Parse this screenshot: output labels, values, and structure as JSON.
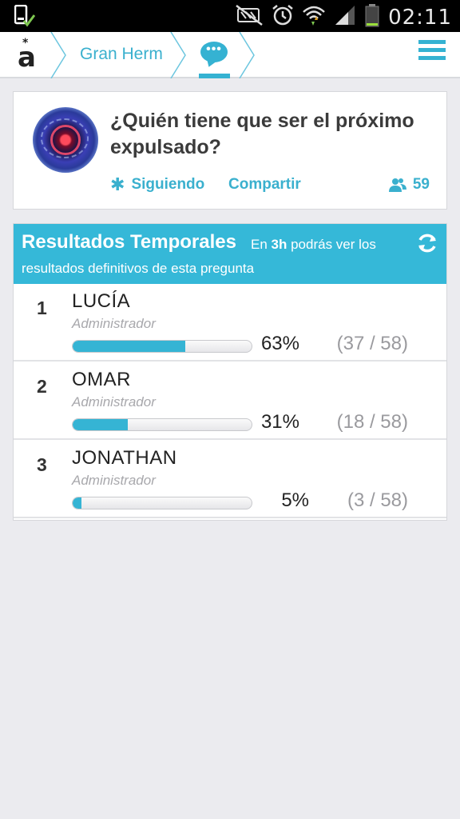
{
  "status_bar": {
    "time": "02:11",
    "icons": [
      "device-check-icon",
      "mute-icon",
      "alarm-icon",
      "wifi-icon",
      "signal-icon",
      "battery-icon"
    ]
  },
  "header": {
    "breadcrumb": "Gran Hermano",
    "icons": [
      "logo-icon",
      "chat-icon",
      "menu-icon"
    ],
    "accent_color": "#35b2d2"
  },
  "question": {
    "title": "¿Quién tiene que ser el próximo expulsado?",
    "follow_label": "Siguiendo",
    "share_label": "Compartir",
    "followers": "59"
  },
  "results": {
    "title": "Resultados Temporales",
    "subtitle_pre": "En ",
    "subtitle_time": "3h",
    "subtitle_post": " podrás ver los",
    "subtitle_line2": "resultados definitivos de esta pregunta",
    "items": [
      {
        "rank": "1",
        "name": "LUCÍA",
        "role": "Administrador",
        "percent_label": "63%",
        "votes": "(37 / 58)",
        "fraction": 0.63
      },
      {
        "rank": "2",
        "name": "OMAR",
        "role": "Administrador",
        "percent_label": "31%",
        "votes": "(18 / 58)",
        "fraction": 0.31
      },
      {
        "rank": "3",
        "name": "JONATHAN",
        "role": "Administrador",
        "percent_label": "5%",
        "votes": "(3 / 58)",
        "fraction": 0.05
      }
    ]
  }
}
